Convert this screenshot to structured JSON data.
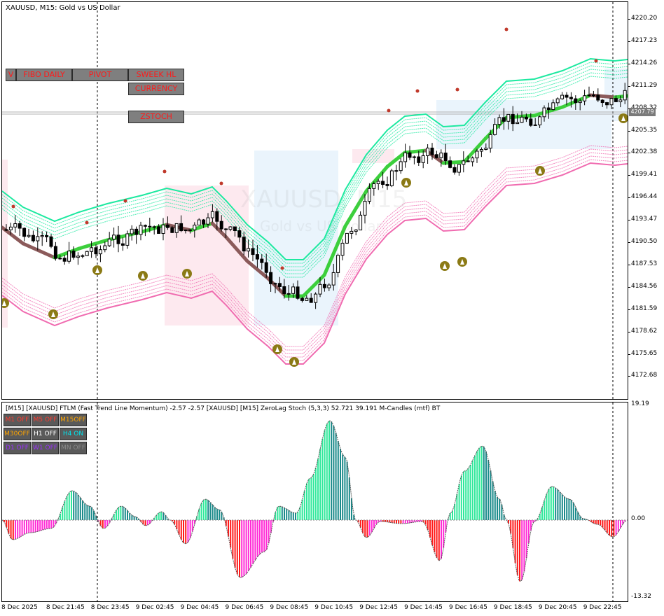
{
  "chart_title": "XAUUSD, M15:  Gold vs US Dollar",
  "watermark": {
    "symbol": "XAUUSD, M15",
    "description": "Gold vs US Dollar"
  },
  "current_price": "4207.79",
  "indicator_title": "[M15] [XAUUSD] FTLM (Fast Trend Line Momentum) -2.57 -2.57 [XAUUSD] [M15] ZeroLag Stoch (5,3,3) 52.721 39.191 M-Candles (mtf) BT",
  "buttons": {
    "v": "V",
    "fibo_daily": "FIBO DAILY",
    "pivot": "PIVOT",
    "sweek_hl": "SWEEK HL",
    "currency": "CURRENCY",
    "zstoch": "ZSTOCH"
  },
  "tf_buttons": [
    {
      "label": "M1 OFF",
      "color": "#ff3b30"
    },
    {
      "label": "M5 OFF",
      "color": "#ff3b30"
    },
    {
      "label": "M15OFF",
      "color": "#ffa500"
    },
    {
      "label": "M30OFF",
      "color": "#ffa500"
    },
    {
      "label": "H1 OFF",
      "color": "#ffffff"
    },
    {
      "label": "H4 ON",
      "color": "#00e5ee"
    },
    {
      "label": "D1 OFF",
      "color": "#9b30ff"
    },
    {
      "label": "W1 OFF",
      "color": "#9b30ff"
    },
    {
      "label": "MN OFF",
      "color": "#8a8a8a"
    }
  ],
  "price_axis": [
    "4220.20",
    "4217.23",
    "4214.26",
    "4211.29",
    "4208.32",
    "4205.35",
    "4202.38",
    "4199.41",
    "4196.44",
    "4193.47",
    "4190.50",
    "4187.53",
    "4184.56",
    "4181.59",
    "4178.62",
    "4175.65",
    "4172.68"
  ],
  "sub_axis": [
    "19.19",
    "0.00",
    "-13.32"
  ],
  "time_axis": [
    "8 Dec 2025",
    "8 Dec 21:45",
    "8 Dec 23:45",
    "9 Dec 02:45",
    "9 Dec 04:45",
    "9 Dec 06:45",
    "9 Dec 08:45",
    "9 Dec 10:45",
    "9 Dec 12:45",
    "9 Dec 14:45",
    "9 Dec 16:45",
    "9 Dec 18:45",
    "9 Dec 20:45",
    "9 Dec 22:45"
  ],
  "colors": {
    "bull_band": "#1de9a0",
    "bear_band": "#f06bb0",
    "trend_up": "#3ccf3c",
    "trend_down": "#8b5a5a",
    "hist_pos_a": "#2ee89a",
    "hist_pos_b": "#1a8a8a",
    "hist_neg_a": "#ff1a1a",
    "hist_neg_b": "#ff2bd6"
  }
}
